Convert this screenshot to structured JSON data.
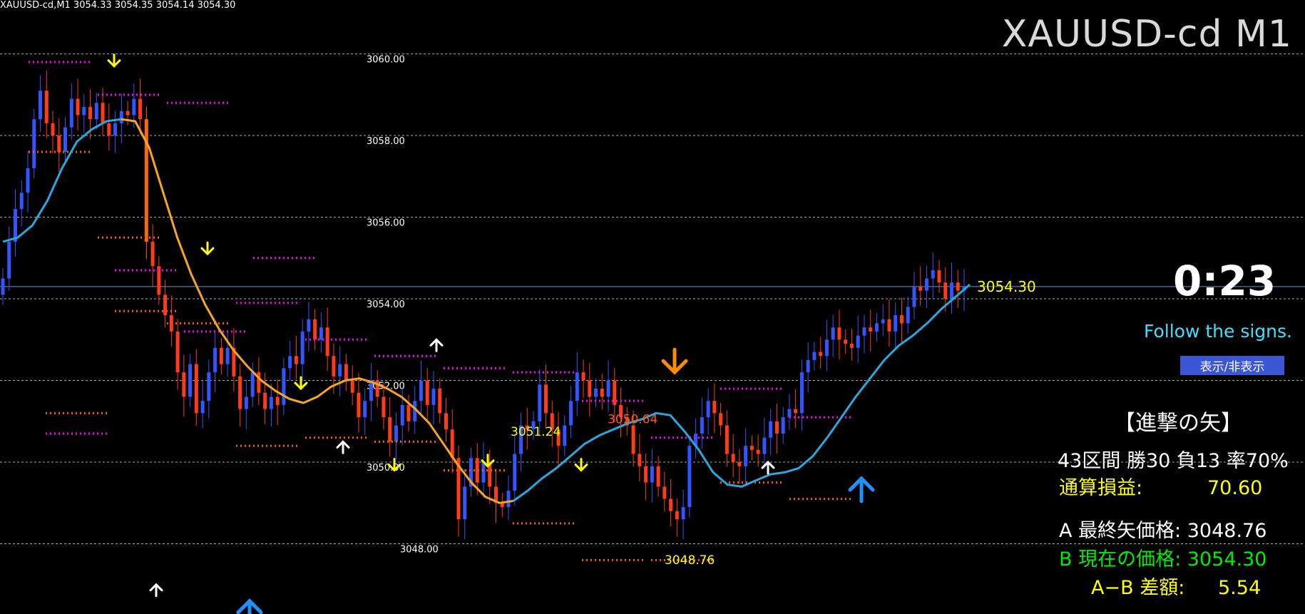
{
  "window": {
    "symbol_info": "XAUUSD-cd,M1  3054.33 3054.35 3054.14 3054.30",
    "big_symbol": "XAUUSD-cd M1"
  },
  "chart_data": {
    "type": "candlestick",
    "price_axis": [
      "3060.00",
      "3058.00",
      "3056.00",
      "3054.00",
      "3052.00",
      "3050.00",
      "3048.00"
    ],
    "ylim": [
      3046.28,
      3061.32
    ],
    "grid": true,
    "candles_close": [
      3054.5,
      3055.4,
      3056.2,
      3056.6,
      3057.2,
      3058.4,
      3059.1,
      3058.3,
      3058.0,
      3057.6,
      3058.2,
      3058.9,
      3058.5,
      3058.7,
      3058.4,
      3058.8,
      3058.3,
      3058.0,
      3058.3,
      3058.6,
      3058.5,
      3058.9,
      3058.4,
      3055.4,
      3054.8,
      3054.1,
      3053.6,
      3053.2,
      3052.2,
      3051.6,
      3052.4,
      3051.2,
      3051.5,
      3052.2,
      3052.8,
      3052.4,
      3052.8,
      3052.1,
      3051.3,
      3051.6,
      3052.2,
      3051.7,
      3051.3,
      3051.6,
      3051.4,
      3052.3,
      3052.6,
      3052.4,
      3053.2,
      3053.5,
      3053.0,
      3053.3,
      3052.6,
      3052.1,
      3052.4,
      3052.0,
      3051.7,
      3051.1,
      3051.5,
      3052.0,
      3051.6,
      3051.1,
      3050.5,
      3050.9,
      3051.4,
      3051.0,
      3051.5,
      3052.0,
      3051.4,
      3051.8,
      3051.2,
      3050.8,
      3050.1,
      3048.6,
      3049.4,
      3050.1,
      3049.5,
      3050.0,
      3049.4,
      3049.0,
      3048.9,
      3049.3,
      3050.2,
      3050.9,
      3050.8,
      3051.0,
      3051.9,
      3051.2,
      3050.8,
      3050.4,
      3050.9,
      3051.5,
      3052.2,
      3052.0,
      3051.6,
      3051.8,
      3051.6,
      3052.0,
      3051.4,
      3051.1,
      3050.9,
      3050.2,
      3049.9,
      3049.5,
      3049.9,
      3049.4,
      3049.1,
      3048.8,
      3048.6,
      3048.9,
      3050.4,
      3050.7,
      3051.1,
      3051.5,
      3051.2,
      3050.9,
      3050.2,
      3050.0,
      3049.9,
      3050.4,
      3050.3,
      3050.2,
      3050.6,
      3051.0,
      3050.7,
      3051.1,
      3051.3,
      3051.2,
      3052.2,
      3052.5,
      3052.7,
      3052.6,
      3053.0,
      3053.3,
      3053.0,
      3052.9,
      3052.8,
      3053.1,
      3053.3,
      3053.2,
      3053.4,
      3053.5,
      3053.2,
      3053.6,
      3053.4,
      3053.8,
      3054.3,
      3054.2,
      3054.5,
      3054.7,
      3054.4,
      3054.0,
      3054.4,
      3054.2,
      3054.3
    ],
    "ma_orange": [
      3058.4,
      3058.35,
      3057.7,
      3056.6,
      3055.5,
      3054.6,
      3053.85,
      3053.25,
      3052.75,
      3052.35,
      3052.0,
      3051.75,
      3051.55,
      3051.45,
      3051.6,
      3051.85,
      3052.0,
      3052.05,
      3051.95,
      3051.8,
      3051.6,
      3051.3,
      3050.95,
      3050.45,
      3049.95,
      3049.5,
      3049.15,
      3049.0,
      3049.05
    ],
    "ma_blue": [
      3055.4,
      3055.5,
      3055.8,
      3056.4,
      3057.2,
      3057.85,
      3058.15,
      3058.35,
      3058.4
    ],
    "ma_blue_2": [
      3049.05,
      3049.3,
      3049.6,
      3049.85,
      3050.15,
      3050.45,
      3050.65,
      3050.8,
      3050.95,
      3051.05,
      3051.2,
      3051.15,
      3050.75,
      3050.3,
      3049.75,
      3049.45,
      3049.4,
      3049.55,
      3049.7,
      3049.75,
      3049.85,
      3050.15,
      3050.6,
      3051.1,
      3051.6,
      3052.05,
      3052.5,
      3052.85,
      3053.1,
      3053.4,
      3053.75,
      3054.05,
      3054.35
    ],
    "current_price": 3054.3,
    "current_price_label": "3054.30",
    "annotations": [
      {
        "label": "3051.24",
        "price": 3050.65,
        "color": "#ffff00"
      },
      {
        "label": "3050.64",
        "price": 3050.95,
        "color": "#ff5a14"
      },
      {
        "label": "3048.76",
        "price": 3047.5,
        "color": "#ffff00"
      }
    ],
    "signals": [
      {
        "type": "arrow-down",
        "color": "#ffff00",
        "price": 3059.7
      },
      {
        "type": "arrow-down",
        "color": "#ffff00",
        "price": 3055.1
      },
      {
        "type": "arrow-down",
        "color": "#ffff00",
        "price": 3051.8
      },
      {
        "type": "arrow-down",
        "color": "#ffff00",
        "price": 3049.8
      },
      {
        "type": "arrow-down",
        "color": "#ffff00",
        "price": 3049.9
      },
      {
        "type": "arrow-down",
        "color": "#ffff00",
        "price": 3049.8
      },
      {
        "type": "arrow-down-big",
        "color": "#ff8c00",
        "price": 3052.2
      },
      {
        "type": "arrow-up",
        "color": "#ffffff",
        "price": 3050.0
      },
      {
        "type": "arrow-up-big",
        "color": "#1e90ff",
        "price": 3049.6
      },
      {
        "type": "arrow-up",
        "color": "#ffffff",
        "price": 3047.0
      },
      {
        "type": "arrow-up-big",
        "color": "#1e90ff",
        "price": 3046.6
      },
      {
        "type": "arrow-up",
        "color": "#ffffff",
        "price": 3050.5
      },
      {
        "type": "arrow-up",
        "color": "#ffffff",
        "price": 3053.0
      }
    ],
    "levels_magenta": [
      {
        "price": 3059.8
      },
      {
        "price": 3059.0
      },
      {
        "price": 3058.8
      },
      {
        "price": 3053.9
      },
      {
        "price": 3053.0
      },
      {
        "price": 3052.6
      },
      {
        "price": 3052.3
      },
      {
        "price": 3052.2
      },
      {
        "price": 3051.5
      },
      {
        "price": 3050.6
      },
      {
        "price": 3051.8
      },
      {
        "price": 3051.1
      },
      {
        "price": 3050.7
      },
      {
        "price": 3054.7
      },
      {
        "price": 3053.2
      },
      {
        "price": 3055.0
      }
    ],
    "levels_orange": [
      {
        "price": 3057.6
      },
      {
        "price": 3055.5
      },
      {
        "price": 3053.4
      },
      {
        "price": 3050.4
      },
      {
        "price": 3050.6
      },
      {
        "price": 3050.5
      },
      {
        "price": 3049.8
      },
      {
        "price": 3048.5
      },
      {
        "price": 3047.6
      },
      {
        "price": 3047.6
      },
      {
        "price": 3049.5
      },
      {
        "price": 3049.1
      },
      {
        "price": 3051.2
      },
      {
        "price": 3053.7
      }
    ],
    "colors": {
      "bull": "#3355ff",
      "bear": "#ff3b1a",
      "bear_tall": "#ff6a00",
      "ma_orange": "#f5a623",
      "ma_blue": "#2aa7dd",
      "magenta": "#ff00ff",
      "orange_dots": "#ff5a00",
      "grid": "#aaaaaa",
      "price_line": "#5c9bd6"
    }
  },
  "overlay": {
    "timer": "0:23",
    "follow_text": "Follow the signs.",
    "toggle_button": "表示/非表示",
    "panel_title": "【進撃の矢】",
    "stats": "43区間 勝30 負13 率70%",
    "pnl_label": "通算損益:",
    "pnl_value": "70.60",
    "last_arrow": "A 最終矢価格: 3048.76",
    "current_price": "B 現在の価格: 3054.30",
    "diff_label": "A−B 差額:",
    "diff_value": "5.54"
  }
}
